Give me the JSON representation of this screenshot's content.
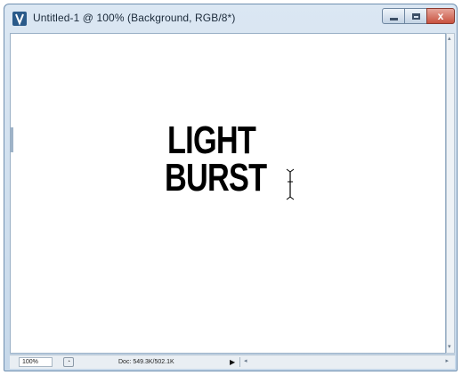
{
  "window": {
    "title": "Untitled-1 @ 100% (Background, RGB/8*)",
    "controls": {
      "minimize": "",
      "maximize": "",
      "close": "x"
    }
  },
  "document": {
    "line1": "LIGHT",
    "line2": "BURST"
  },
  "statusbar": {
    "zoom": "100%",
    "doc_info": "Doc: 549.3K/502.1K",
    "play_arrow": "▶",
    "scroll_left": "◂",
    "scroll_right": "▸"
  },
  "scrollbar": {
    "up": "▴",
    "down": "▾"
  },
  "colors": {
    "title_gradient_top": "#dbe7f3",
    "close_button": "#c8523f",
    "canvas": "#ffffff",
    "text": "#000000"
  },
  "icons": {
    "app": "photoshop-app-icon",
    "cursor": "text-insertion-cursor-icon"
  }
}
